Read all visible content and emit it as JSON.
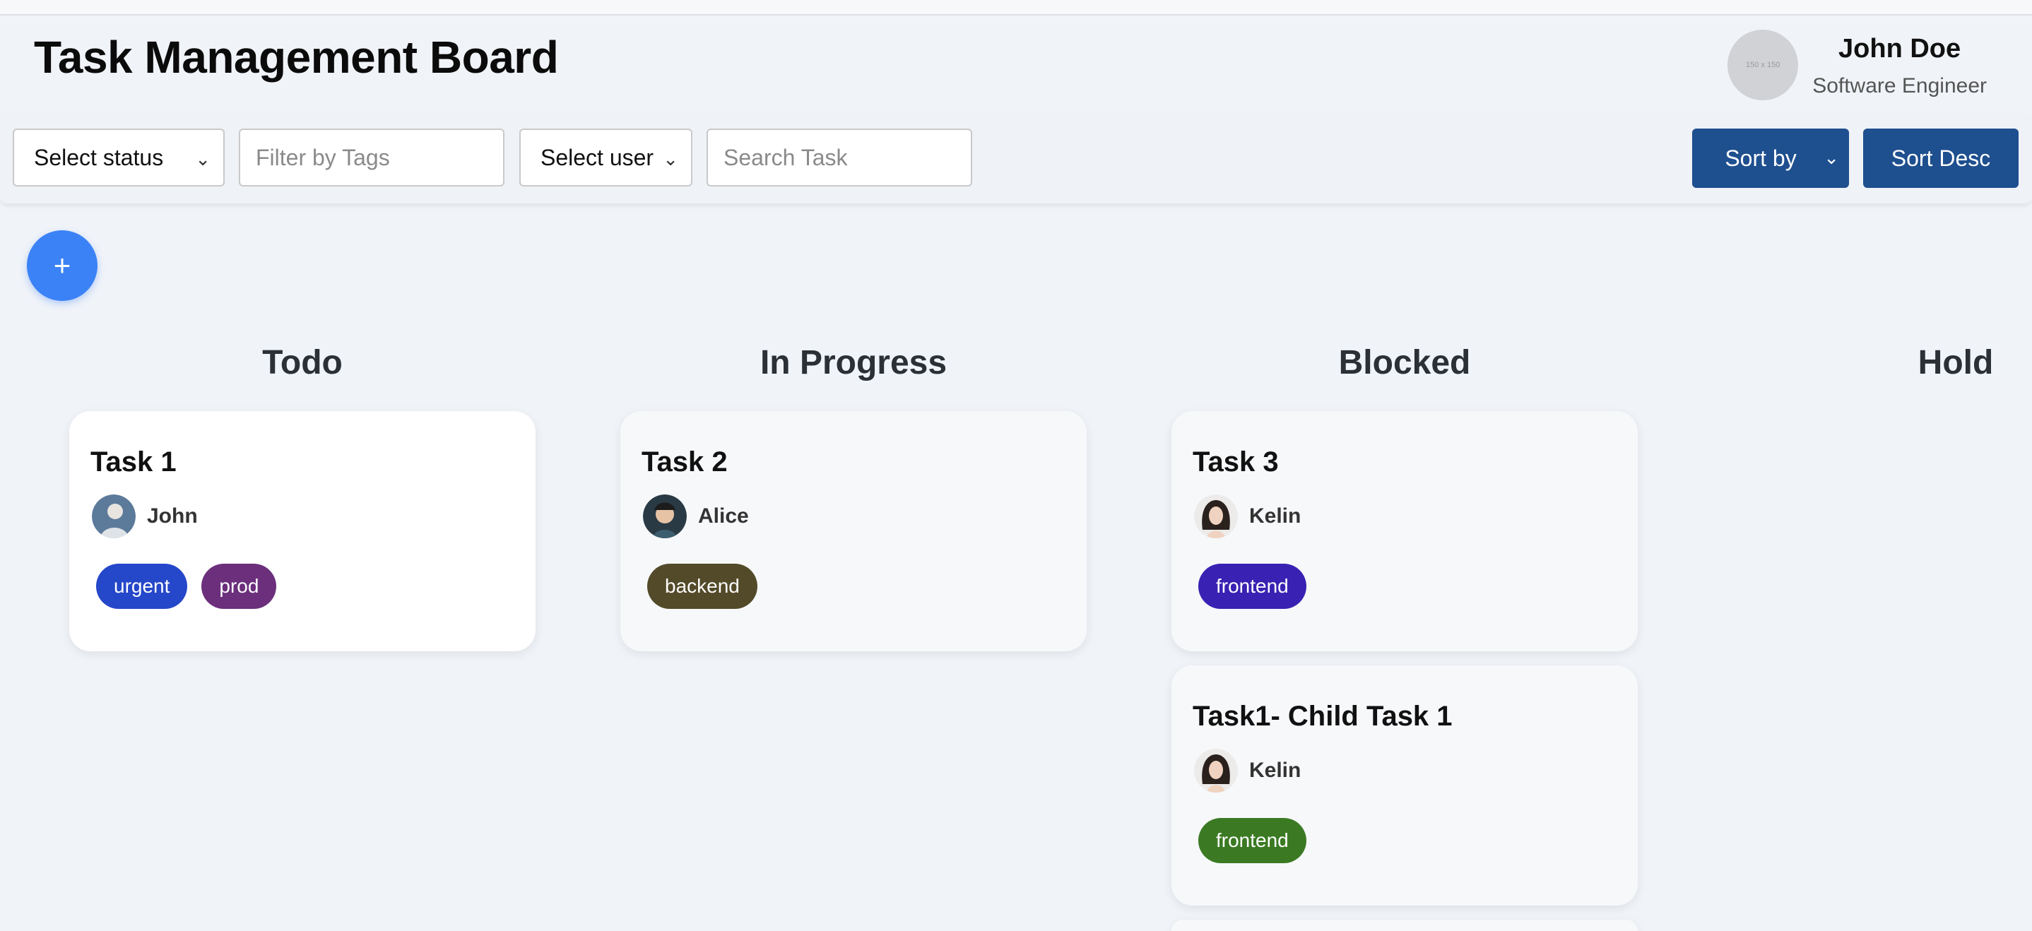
{
  "header": {
    "title": "Task Management Board",
    "avatar_text": "150 x 150",
    "user_name": "John Doe",
    "user_role": "Software Engineer"
  },
  "filters": {
    "status_select": "Select status",
    "tags_placeholder": "Filter by Tags",
    "user_select": "Select user",
    "search_placeholder": "Search Task",
    "sort_by": "Sort by",
    "sort_order": "Sort Desc"
  },
  "add_button": "+",
  "columns": [
    {
      "title": "Todo"
    },
    {
      "title": "In Progress"
    },
    {
      "title": "Blocked"
    },
    {
      "title": "Hold"
    }
  ],
  "cards": [
    {
      "title": "Task 1",
      "assignee": "John",
      "avatar": "man-avatar-icon",
      "tags": [
        {
          "label": "urgent",
          "color": "#2547c9"
        },
        {
          "label": "prod",
          "color": "#6b2f7c"
        }
      ]
    },
    {
      "title": "Task 2",
      "assignee": "Alice",
      "avatar": "child-avatar-icon",
      "tags": [
        {
          "label": "backend",
          "color": "#534a29"
        }
      ]
    },
    {
      "title": "Task 3",
      "assignee": "Kelin",
      "avatar": "woman-avatar-icon",
      "tags": [
        {
          "label": "frontend",
          "color": "#3921b3"
        }
      ]
    },
    {
      "title": "Task1- Child Task 1",
      "assignee": "Kelin",
      "avatar": "woman-avatar-icon",
      "tags": [
        {
          "label": "frontend",
          "color": "#3b7a23"
        }
      ]
    }
  ],
  "colors": {
    "primary_button": "#1e4f8f",
    "fab": "#3b82f6",
    "background": "#f0f3f8"
  }
}
